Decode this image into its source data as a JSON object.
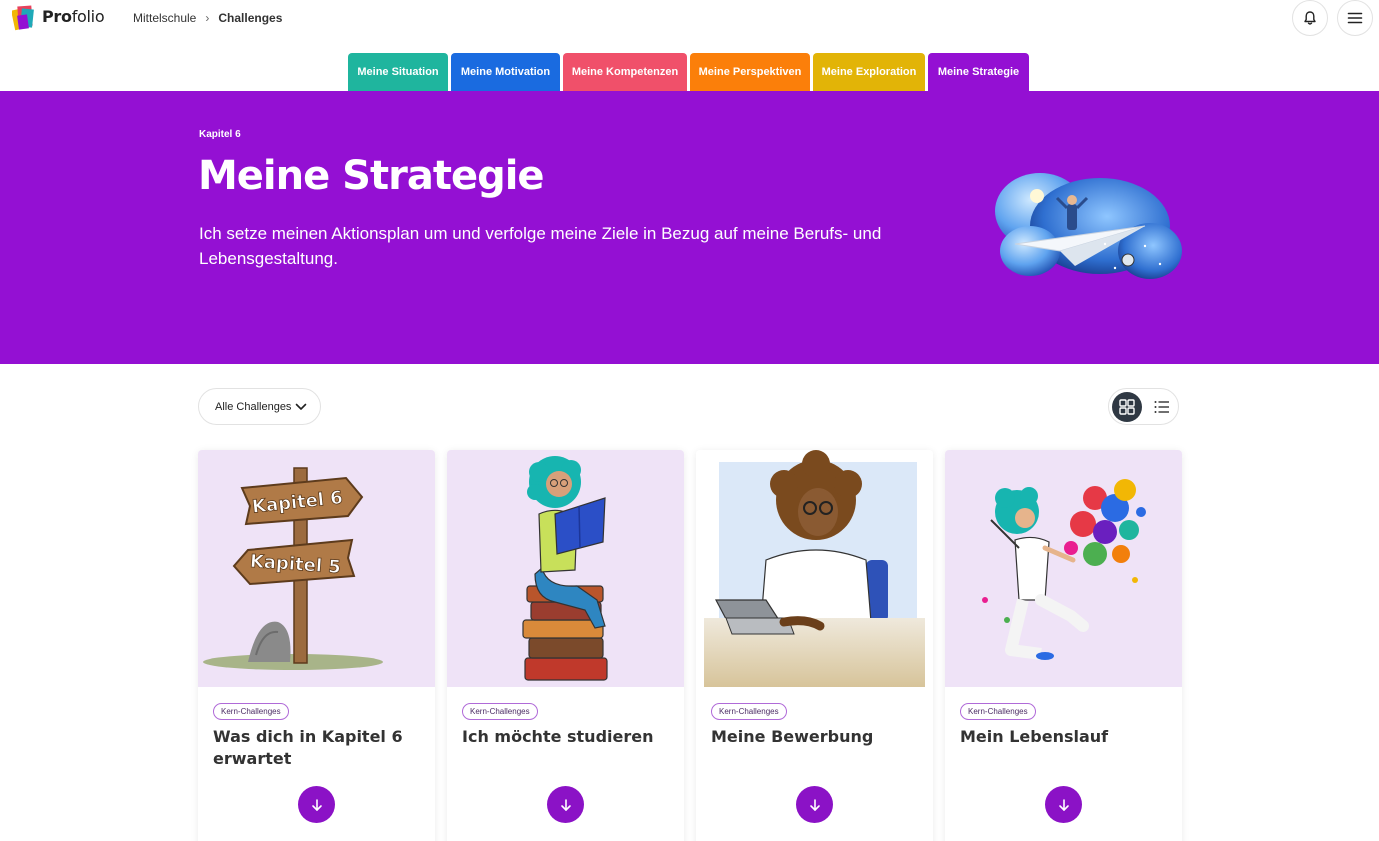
{
  "app": {
    "logo_bold": "Pro",
    "logo_rest": "folio"
  },
  "breadcrumb": {
    "parent": "Mittelschule",
    "separator": "›",
    "current": "Challenges"
  },
  "tabs": [
    {
      "label": "Meine Situation",
      "color": "#1fb59e"
    },
    {
      "label": "Meine Motivation",
      "color": "#1a6be0"
    },
    {
      "label": "Meine Kompetenzen",
      "color": "#f0506a"
    },
    {
      "label": "Meine Perspektiven",
      "color": "#fb7f0a"
    },
    {
      "label": "Meine Exploration",
      "color": "#e2b407"
    },
    {
      "label": "Meine Strategie",
      "color": "#9410d3",
      "active": true
    }
  ],
  "hero": {
    "kapitel": "Kapitel 6",
    "title": "Meine Strategie",
    "description": "Ich setze meinen Aktionsplan um und verfolge meine Ziele in Bezug auf meine Berufs- und Lebensgestaltung.",
    "background": "#9410d3"
  },
  "filter": {
    "label": "Alle Challenges"
  },
  "view_toggle": {
    "active": "grid"
  },
  "cards": [
    {
      "badge": "Kern-Challenges",
      "title": "Was dich in Kapitel 6 erwartet",
      "image": "signpost",
      "sign1": "Kapitel 6",
      "sign2": "Kapitel 5"
    },
    {
      "badge": "Kern-Challenges",
      "title": "Ich möchte studieren",
      "image": "reader-on-books"
    },
    {
      "badge": "Kern-Challenges",
      "title": "Meine Bewerbung",
      "image": "person-with-laptop"
    },
    {
      "badge": "Kern-Challenges",
      "title": "Mein Lebenslauf",
      "image": "paint-splash-dancer"
    }
  ],
  "icons": {
    "notification": "bell-icon",
    "menu": "hamburger-icon",
    "download": "arrow-down-icon",
    "dropdown": "chevron-down-icon",
    "grid": "grid-view-icon",
    "list": "list-view-icon"
  }
}
